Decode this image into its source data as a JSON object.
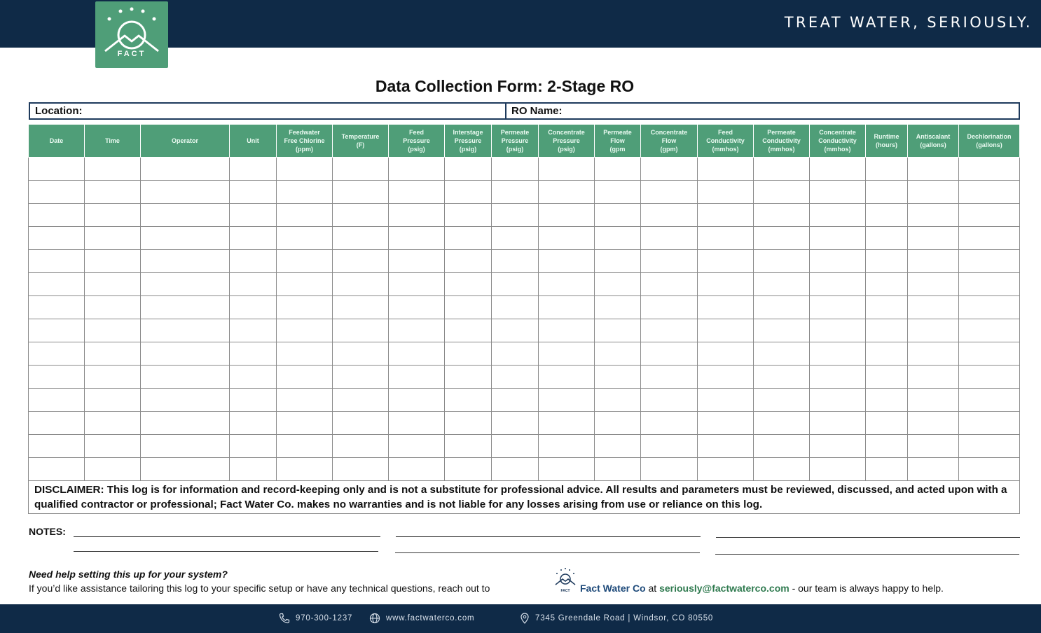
{
  "header": {
    "logo_text": "FACT",
    "tagline": "TREAT WATER, SERIOUSLY."
  },
  "form": {
    "title": "Data Collection Form: 2-Stage RO",
    "location_label": "Location:",
    "ro_name_label": "RO Name:"
  },
  "table": {
    "columns": [
      "Date",
      "Time",
      "Operator",
      "Unit",
      "Feedwater\nFree Chlorine\n(ppm)",
      "Temperature\n(F)",
      "Feed\nPressure\n(psig)",
      "Interstage\nPressure\n(psig)",
      "Permeate\nPressure\n(psig)",
      "Concentrate\nPressure\n(psig)",
      "Permeate\nFlow\n(gpm",
      "Concentrate\nFlow\n(gpm)",
      "Feed\nConductivity\n(mmhos)",
      "Permeate\nConductivity\n(mmhos)",
      "Concentrate\nConductivity\n(mmhos)",
      "Runtime\n(hours)",
      "Antiscalant\n(gallons)",
      "Dechlorination\n(gallons)"
    ],
    "blank_rows": 14,
    "disclaimer": "DISCLAIMER: This log is for information and record-keeping only and is not a substitute for professional advice. All results and parameters must be reviewed, discussed, and acted upon with a qualified contractor or professional; Fact Water Co. makes no warranties and is not liable for any losses arising from use or reliance on this log."
  },
  "notes": {
    "label": "NOTES:"
  },
  "help": {
    "question": "Need help setting this up for your system?",
    "text": "If you’d like assistance tailoring this log to your specific setup or have any technical questions, reach out to",
    "mini_logo_text": "FACT",
    "brand": "Fact Water Co",
    "at": " at ",
    "email": "seriously@factwaterco.com",
    "tail": " - our team is always happy to help."
  },
  "footer": {
    "phone": "970-300-1237",
    "website": "www.factwaterco.com",
    "address": "7345 Greendale Road | Windsor, CO 80550"
  },
  "colors": {
    "navy": "#0f2a47",
    "green": "#4f9e78",
    "email_green": "#2f7a4f",
    "brand_blue": "#1e4a7a"
  }
}
